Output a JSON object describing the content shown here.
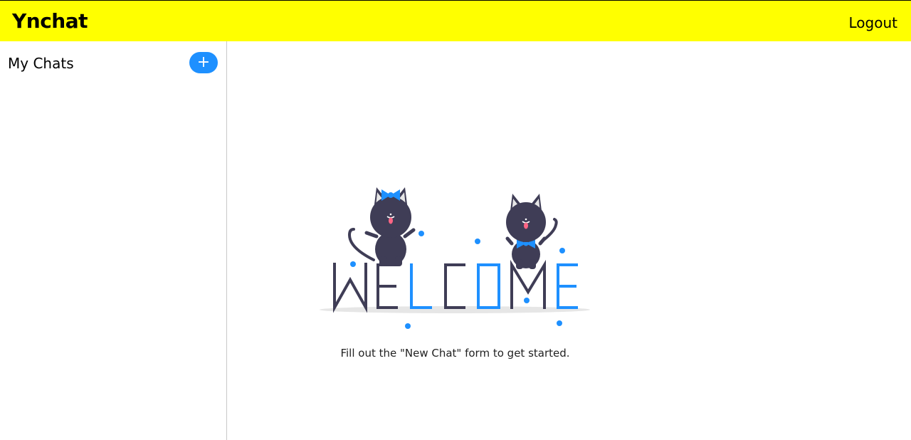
{
  "app": {
    "title": "Ynchat",
    "logout_label": "Logout"
  },
  "sidebar": {
    "title": "My Chats",
    "add_button_label": "+"
  },
  "main": {
    "illustration": "welcome-cats-illustration",
    "hint": "Fill out the \"New Chat\" form to get started."
  },
  "colors": {
    "topbar": "#ffff00",
    "accent": "#1e90ff",
    "dark": "#3f3d56"
  }
}
